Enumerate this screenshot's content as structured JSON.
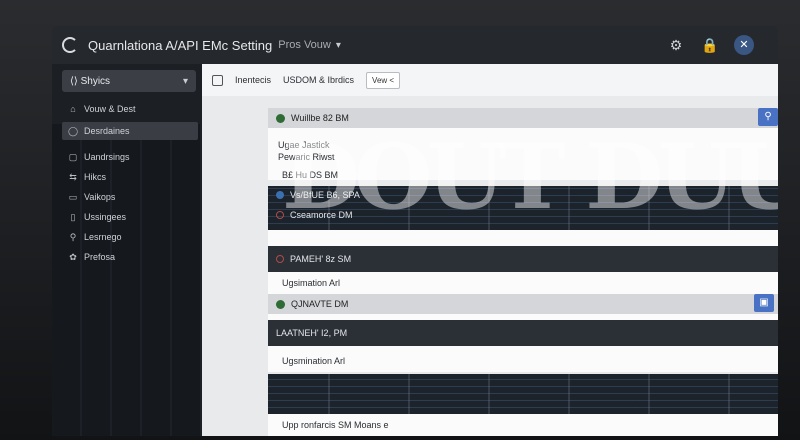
{
  "window": {
    "title": "Quarnlationa A/API EMc Setting",
    "subtitle": "Pros Vouw",
    "icons": [
      "gear-icon",
      "lock-icon",
      "close-icon"
    ]
  },
  "sidebar": {
    "select_label": "Shyics",
    "items": [
      {
        "icon": "home-icon",
        "label": "Vouw & Dest"
      },
      {
        "icon": "user-icon",
        "label": "Desrdaines"
      },
      {
        "icon": "grid-icon",
        "label": "Uandrsings"
      },
      {
        "icon": "share-icon",
        "label": "Hikcs"
      },
      {
        "icon": "monitor-icon",
        "label": "Vaikops"
      },
      {
        "icon": "file-icon",
        "label": "Ussingees"
      },
      {
        "icon": "search-icon",
        "label": "Lesrnego"
      },
      {
        "icon": "settings-icon",
        "label": "Prefosa"
      }
    ]
  },
  "main": {
    "breadcrumb_a": "Inentecis",
    "breadcrumb_b": "USDOM & Ibrdics",
    "view_button": "Vew <"
  },
  "cards": [
    {
      "head": "Wuillbe 82 BM",
      "line1": "Ugae Jastick",
      "line2": "Pewaric Riwst"
    },
    {
      "label": "B£ Hu DS BM"
    },
    {
      "head": "Vs/BfUE B6, SPA",
      "sub": "Cseamorce DM"
    },
    {
      "head": "PAMEH' 8z SM"
    },
    {
      "label": "Ugsimation Arl"
    },
    {
      "head": "QJNAVTE DM"
    },
    {
      "head": "LAATNEH' I2, PM"
    },
    {
      "label": "Ugsmination Arl"
    },
    {
      "label": "Upp ronfarcis SM Moans e"
    }
  ],
  "colors": {
    "accent": "#4a72c4",
    "sidebar": "#1c1f23",
    "status_green": "#2f6b35"
  }
}
